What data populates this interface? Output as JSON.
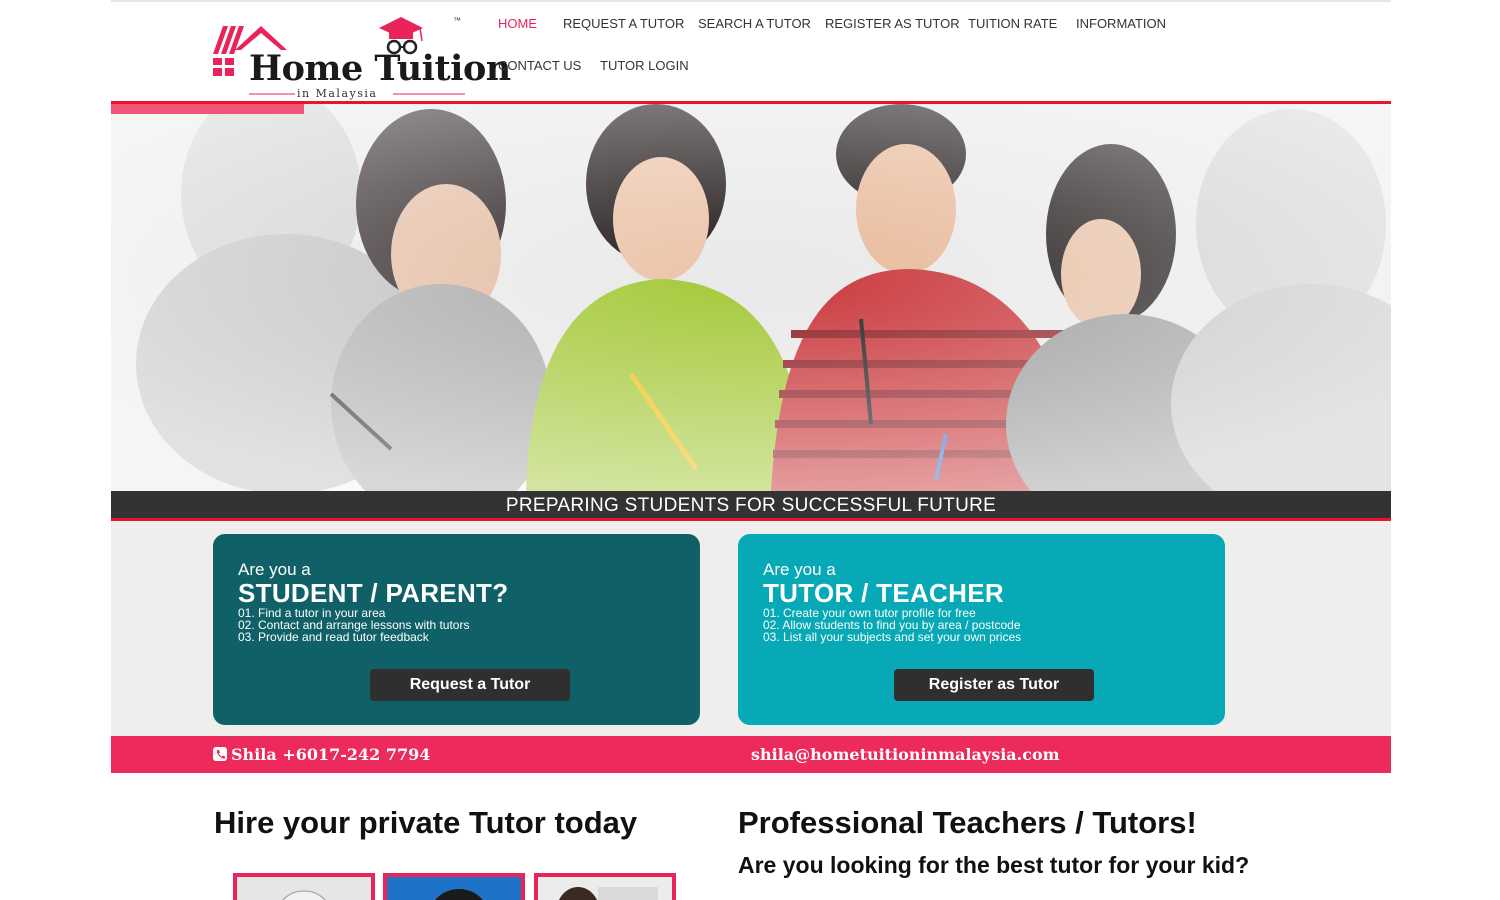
{
  "brand": {
    "name": "Home Tuition",
    "tagline": "in Malaysia",
    "trademark": "™",
    "colors": {
      "pink": "#e8245a",
      "red_rule": "#e8142c",
      "dark_teal": "#106167",
      "teal": "#06a9b5"
    }
  },
  "nav": {
    "items": [
      {
        "label": "HOME",
        "active": true
      },
      {
        "label": "REQUEST A TUTOR",
        "active": false
      },
      {
        "label": "SEARCH A TUTOR",
        "active": false
      },
      {
        "label": "REGISTER AS TUTOR",
        "active": false
      },
      {
        "label": "TUITION RATE",
        "active": false
      },
      {
        "label": "INFORMATION",
        "active": false
      },
      {
        "label": "CONTACT US",
        "active": false
      },
      {
        "label": "TUTOR LOGIN",
        "active": false
      }
    ]
  },
  "hero": {
    "caption": "PREPARING STUDENTS FOR SUCCESSFUL FUTURE"
  },
  "cards": {
    "student": {
      "pre": "Are you a",
      "title": "STUDENT / PARENT?",
      "points": [
        "01. Find a tutor in your area",
        "02. Contact and arrange lessons with tutors",
        "03. Provide and read tutor feedback"
      ],
      "button": "Request a Tutor"
    },
    "tutor": {
      "pre": "Are you a",
      "title": "TUTOR / TEACHER",
      "points": [
        "01. Create your own tutor profile for free",
        "02. Allow students to find you by area / postcode",
        "03. List all your subjects and set your own prices"
      ],
      "button": "Register as Tutor"
    }
  },
  "contact": {
    "phone": "Shila +6017-242 7794",
    "email": "shila@hometuitioninmalaysia.com"
  },
  "sections": {
    "hire_heading": "Hire your private Tutor today",
    "pro_heading": "Professional Teachers / Tutors!",
    "pro_subheading": "Are you looking for the best tutor for your kid?"
  }
}
